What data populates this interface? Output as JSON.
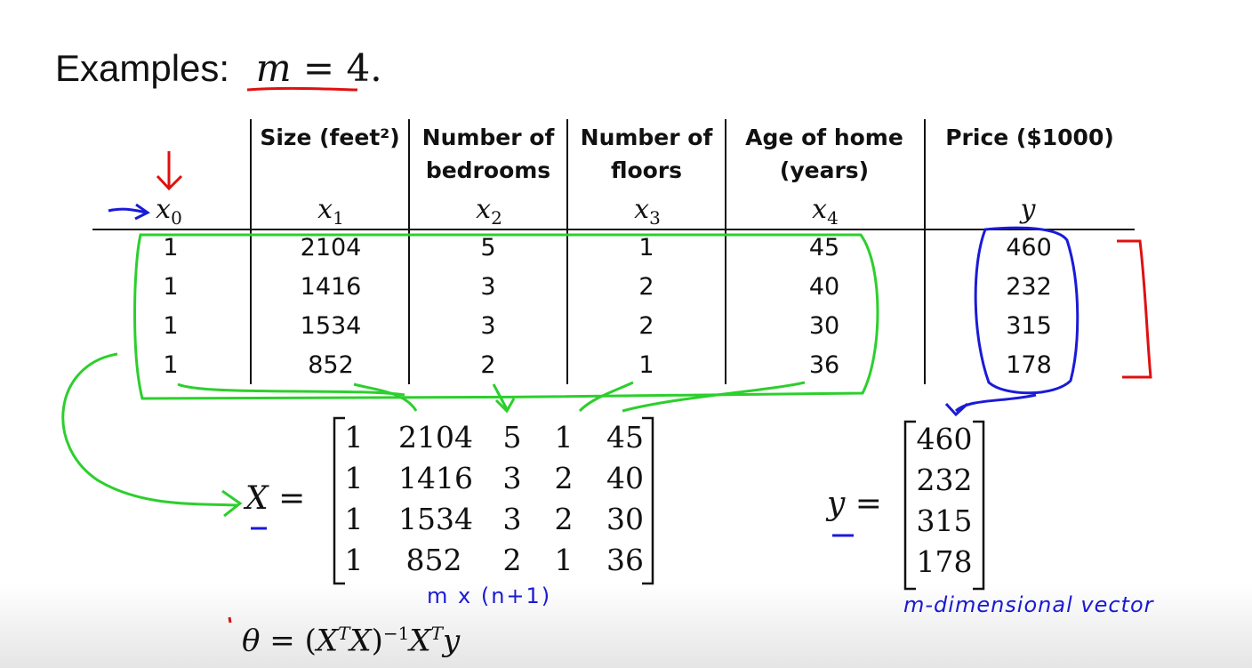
{
  "title": {
    "label": "Examples:",
    "m_var": "m",
    "m_eq": " = 4."
  },
  "table": {
    "headers": [
      {
        "line1": "",
        "line2": "",
        "var": "x",
        "sub": "0"
      },
      {
        "line1": "Size (feet²)",
        "line2": "",
        "var": "x",
        "sub": "1"
      },
      {
        "line1": "Number of",
        "line2": "bedrooms",
        "var": "x",
        "sub": "2"
      },
      {
        "line1": "Number of",
        "line2": "floors",
        "var": "x",
        "sub": "3"
      },
      {
        "line1": "Age of home",
        "line2": "(years)",
        "var": "x",
        "sub": "4"
      },
      {
        "line1": "Price ($1000)",
        "line2": "",
        "var": "y",
        "sub": ""
      }
    ],
    "rows": [
      [
        "1",
        "2104",
        "5",
        "1",
        "45",
        "460"
      ],
      [
        "1",
        "1416",
        "3",
        "2",
        "40",
        "232"
      ],
      [
        "1",
        "1534",
        "3",
        "2",
        "30",
        "315"
      ],
      [
        "1",
        "852",
        "2",
        "1",
        "36",
        "178"
      ]
    ]
  },
  "matrix_x": {
    "label": "X",
    "eq": "=",
    "rows": [
      [
        "1",
        "2104",
        "5",
        "1",
        "45"
      ],
      [
        "1",
        "1416",
        "3",
        "2",
        "40"
      ],
      [
        "1",
        "1534",
        "3",
        "2",
        "30"
      ],
      [
        "1",
        "852",
        "2",
        "1",
        "36"
      ]
    ],
    "annotation": "m x (n+1)"
  },
  "vector_y": {
    "label": "y",
    "eq": "=",
    "values": [
      "460",
      "232",
      "315",
      "178"
    ],
    "annotation": "m-dimensional vector"
  },
  "formula": {
    "theta": "θ",
    "eq": " = (",
    "xt": "X",
    "t1": "T",
    "x": "X",
    "close": ")",
    "inv": "−1",
    "x2": "X",
    "t2": "T",
    "y": "y"
  },
  "colors": {
    "green": "#2ccf2c",
    "blue": "#1a1ad8",
    "red": "#e01010"
  }
}
